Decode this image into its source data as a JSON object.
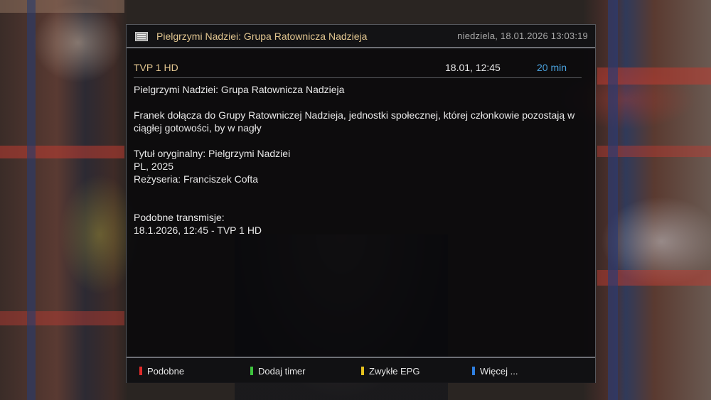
{
  "header": {
    "title": "Pielgrzymi Nadziei: Grupa Ratownicza Nadzieja",
    "datetime": "niedziela, 18.01.2026  13:03:19",
    "icon": "epg-info-icon"
  },
  "event": {
    "channel": "TVP 1 HD",
    "start": "18.01, 12:45",
    "duration": "20 min",
    "lines": {
      "title": "Pielgrzymi Nadziei: Grupa Ratownicza Nadzieja",
      "desc1": "Franek dołącza do Grupy Ratowniczej Nadzieja, jednostki społecznej, której członkowie pozostają w",
      "desc2": "ciągłej gotowości, by w nagły",
      "orig": "Tytuł oryginalny: Pielgrzymi Nadziei",
      "country": "PL, 2025",
      "director": "Reżyseria: Franciszek Cofta",
      "similar_header": "Podobne transmisje:",
      "similar_item": "18.1.2026, 12:45  -  TVP 1 HD"
    }
  },
  "footer": {
    "red": "Podobne",
    "green": "Dodaj timer",
    "yellow": "Zwykłe EPG",
    "blue": "Więcej ..."
  },
  "colors": {
    "red": "#e02a2a",
    "green": "#3ec43e",
    "yellow": "#e6c21e",
    "blue": "#2f7fe0",
    "accent": "#e2c690",
    "duration": "#4aa3df"
  }
}
